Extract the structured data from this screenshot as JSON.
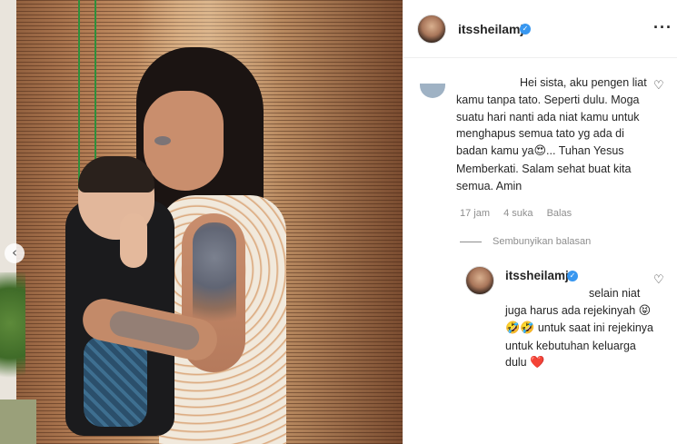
{
  "carousel": {
    "prev_icon": "chevron-left-icon",
    "prev_glyph": "‹"
  },
  "header": {
    "username": "itssheilamj",
    "verified_glyph": "✓",
    "more_glyph": "···"
  },
  "comment": {
    "text_1": "Hei sista, aku pengen liat kamu tanpa tato. Seperti dulu. Moga suatu hari nanti ada niat kamu untuk menghapus semua tato yg ada di badan kamu ya",
    "emoji_1": "😍",
    "text_2": "... Tuhan Yesus Memberkati. Salam sehat buat kita semua. Amin",
    "time": "17 jam",
    "likes": "4 suka",
    "reply_label": "Balas",
    "like_glyph": "♡"
  },
  "hide_replies": {
    "label": "Sembunyikan balasan"
  },
  "reply": {
    "username": "itssheilamj",
    "verified_glyph": "✓",
    "text_1": "selain niat juga harus ada rejekinyah",
    "emojis_1": "😝🤣🤣",
    "text_2": "untuk saat ini rejekinya untuk kebutuhan keluarga dulu",
    "emoji_2": "❤️",
    "like_glyph": "♡"
  },
  "colors": {
    "verified": "#3897f0",
    "muted": "#8e8e8e",
    "text": "#262626",
    "heart": "#ed4956"
  }
}
